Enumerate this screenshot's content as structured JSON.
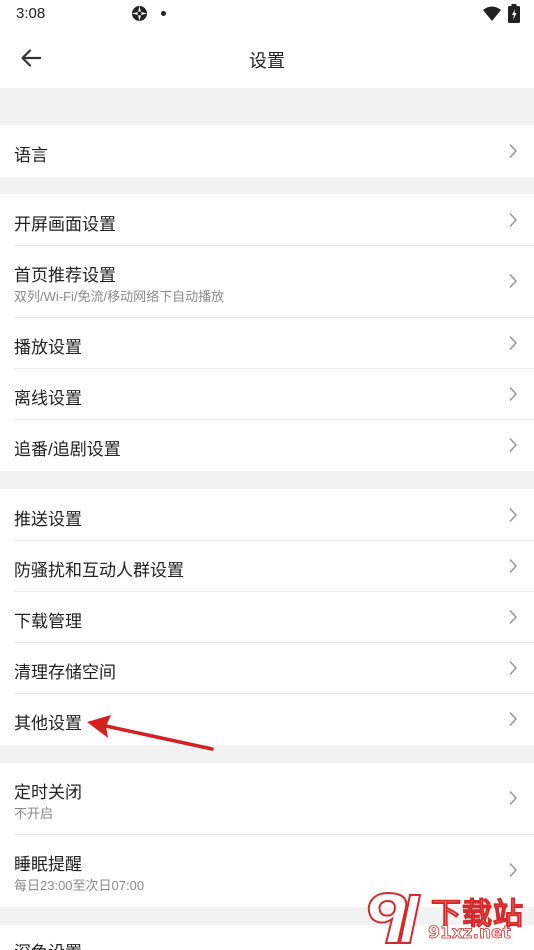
{
  "status_bar": {
    "time": "3:08"
  },
  "header": {
    "title": "设置"
  },
  "sections": {
    "language": {
      "label": "语言"
    },
    "splash": {
      "label": "开屏画面设置"
    },
    "home_recommend": {
      "label": "首页推荐设置",
      "sub": "双列/Wi-Fi/免流/移动网络下自动播放"
    },
    "playback": {
      "label": "播放设置"
    },
    "offline": {
      "label": "离线设置"
    },
    "follow": {
      "label": "追番/追剧设置"
    },
    "push": {
      "label": "推送设置"
    },
    "anti_harass": {
      "label": "防骚扰和互动人群设置"
    },
    "download": {
      "label": "下载管理"
    },
    "clean_storage": {
      "label": "清理存储空间"
    },
    "other": {
      "label": "其他设置"
    },
    "timer_close": {
      "label": "定时关闭",
      "sub": "不开启"
    },
    "sleep_reminder": {
      "label": "睡眠提醒",
      "sub": "每日23:00至次日07:00"
    },
    "dark_mode": {
      "label": "深色设置"
    }
  },
  "annotation": {
    "arrow_color": "#d42020"
  },
  "watermark": {
    "logo_text": "下载站",
    "domain": "91xz.net"
  }
}
